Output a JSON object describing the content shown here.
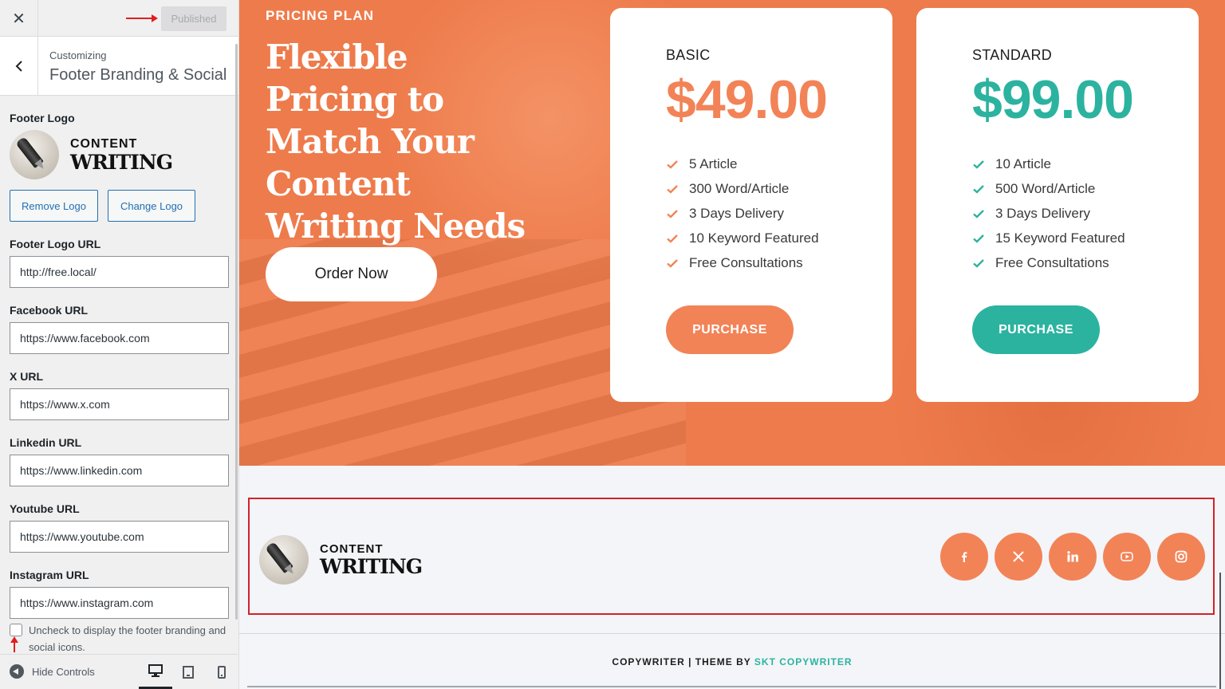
{
  "customizer": {
    "close_icon": "close-icon",
    "published_label": "Published",
    "breadcrumb": "Customizing",
    "section_title": "Footer Branding & Social",
    "footer_logo_label": "Footer Logo",
    "logo": {
      "line1": "CONTENT",
      "line2": "WRITING"
    },
    "remove_logo_label": "Remove Logo",
    "change_logo_label": "Change Logo",
    "fields": [
      {
        "label": "Footer Logo URL",
        "value": "http://free.local/"
      },
      {
        "label": "Facebook URL",
        "value": "https://www.facebook.com"
      },
      {
        "label": "X URL",
        "value": "https://www.x.com"
      },
      {
        "label": "Linkedin URL",
        "value": "https://www.linkedin.com"
      },
      {
        "label": "Youtube URL",
        "value": "https://www.youtube.com"
      },
      {
        "label": "Instagram URL",
        "value": "https://www.instagram.com"
      }
    ],
    "checkbox_text": "Uncheck to display the footer branding and social icons.",
    "hide_controls_label": "Hide Controls",
    "devices": [
      "desktop-icon",
      "tablet-icon",
      "mobile-icon"
    ],
    "annotation_color": "#e01e1e"
  },
  "hero": {
    "eyebrow": "PRICING PLAN",
    "title": "Flexible Pricing to Match Your Content Writing Needs",
    "order_label": "Order Now",
    "background_color": "#ee7b4b"
  },
  "plans": [
    {
      "name": "BASIC",
      "price": "$49.00",
      "accent": "#f28357",
      "features": [
        "5 Article",
        "300 Word/Article",
        "3 Days Delivery",
        "10 Keyword Featured",
        "Free Consultations"
      ],
      "button_label": "PURCHASE"
    },
    {
      "name": "STANDARD",
      "price": "$99.00",
      "accent": "#2bb3a0",
      "features": [
        "10 Article",
        "500 Word/Article",
        "3 Days Delivery",
        "15 Keyword Featured",
        "Free Consultations"
      ],
      "button_label": "PURCHASE"
    }
  ],
  "footer": {
    "logo": {
      "line1": "CONTENT",
      "line2": "WRITING"
    },
    "social": [
      "facebook-icon",
      "x-icon",
      "linkedin-icon",
      "youtube-icon",
      "instagram-icon"
    ],
    "social_color": "#f28357",
    "highlight_color": "#d4212a",
    "copyright_prefix": "COPYWRITER | THEME BY",
    "copyright_link": "SKT COPYWRITER"
  }
}
